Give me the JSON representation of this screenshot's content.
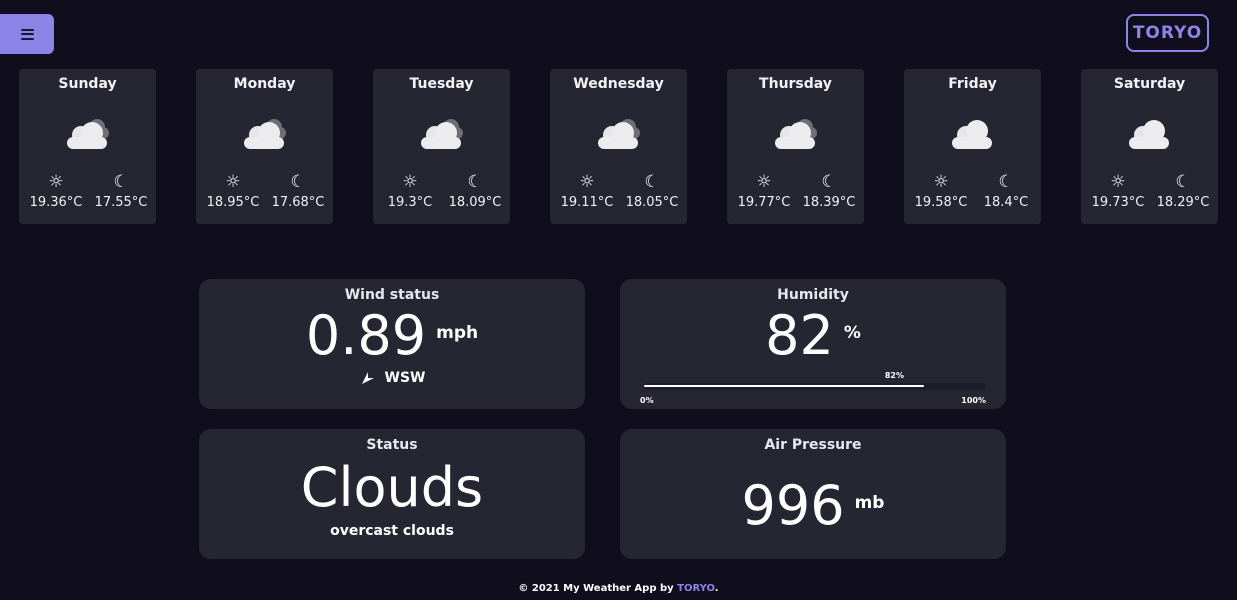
{
  "header": {
    "menu_icon": "hamburger-menu-icon",
    "logo_text": "TORYO"
  },
  "forecast": [
    {
      "day": "Sunday",
      "icon": "cloudy-icon",
      "min": "19.36°C",
      "max": "17.55°C"
    },
    {
      "day": "Monday",
      "icon": "cloudy-icon",
      "min": "18.95°C",
      "max": "17.68°C"
    },
    {
      "day": "Tuesday",
      "icon": "cloudy-icon",
      "min": "19.3°C",
      "max": "18.09°C"
    },
    {
      "day": "Wednesday",
      "icon": "cloudy-icon",
      "min": "19.11°C",
      "max": "18.05°C"
    },
    {
      "day": "Thursday",
      "icon": "cloudy-icon",
      "min": "19.77°C",
      "max": "18.39°C"
    },
    {
      "day": "Friday",
      "icon": "cloud-icon",
      "min": "19.58°C",
      "max": "18.4°C"
    },
    {
      "day": "Saturday",
      "icon": "cloud-icon",
      "min": "19.73°C",
      "max": "18.29°C"
    }
  ],
  "highlights": {
    "wind": {
      "title": "Wind status",
      "value": "0.89",
      "unit": "mph",
      "direction": "WSW"
    },
    "humidity": {
      "title": "Humidity",
      "value": "82",
      "unit": "%",
      "bar_label": "82%",
      "bar_percent": 82,
      "bar_min": "0%",
      "bar_max": "100%"
    },
    "status": {
      "title": "Status",
      "value": "Clouds",
      "description": "overcast clouds"
    },
    "pressure": {
      "title": "Air Pressure",
      "value": "996",
      "unit": "mb"
    }
  },
  "footer": {
    "text": "© 2021 My Weather App by ",
    "brand": "TORYO",
    "end": "."
  },
  "colors": {
    "background": "#100e1d",
    "card": "#262633",
    "accent": "#8d84e8"
  }
}
